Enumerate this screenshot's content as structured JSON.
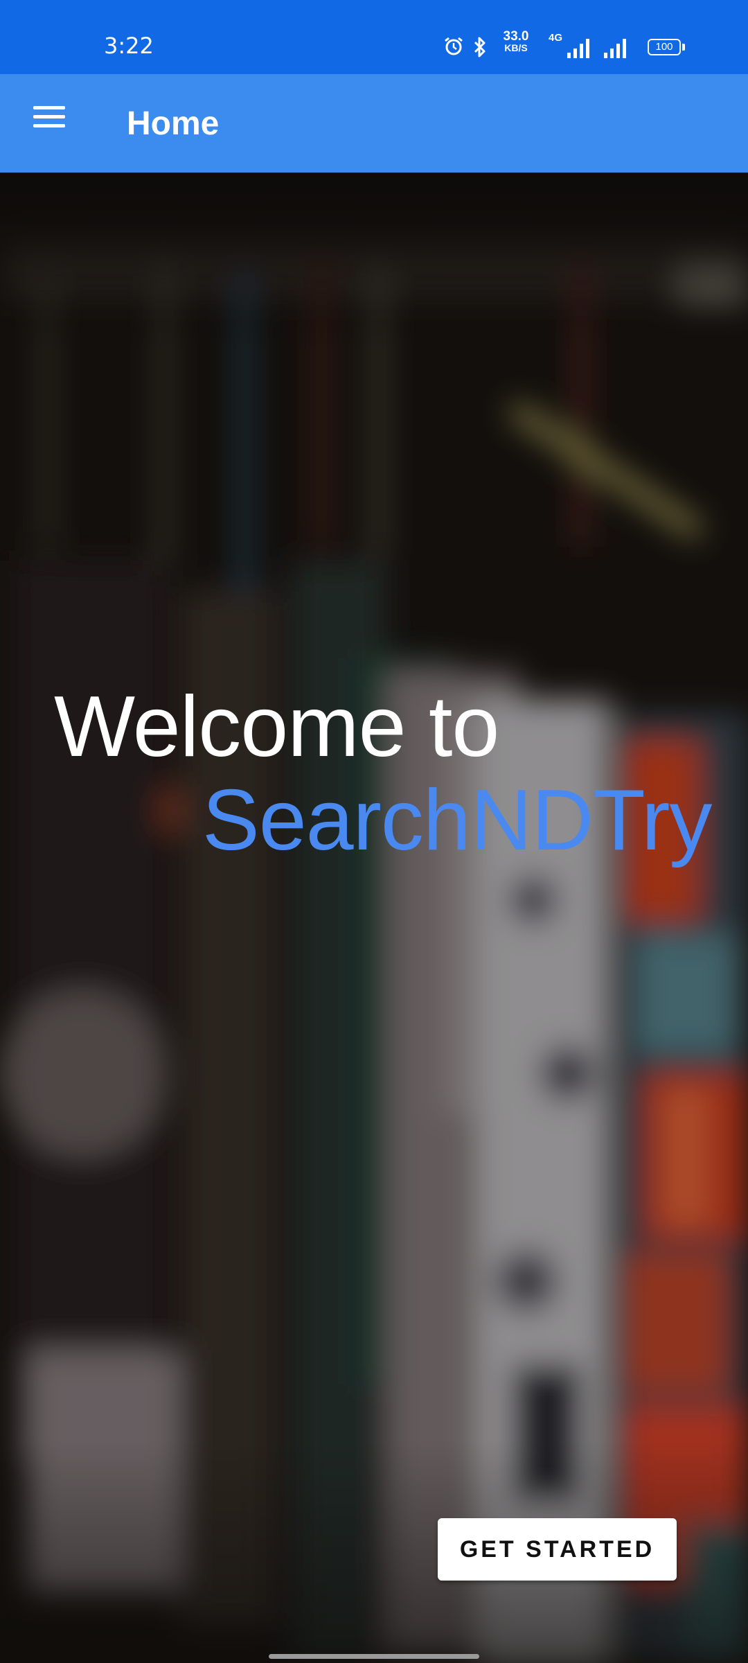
{
  "status_bar": {
    "time": "3:22",
    "network_speed": "33.0",
    "network_speed_unit": "KB/S",
    "network_type": "4G",
    "battery": "100",
    "icons": [
      "alarm-icon",
      "bluetooth-icon",
      "signal-icon",
      "signal-icon",
      "battery-icon"
    ]
  },
  "app_bar": {
    "menu_icon": "menu-icon",
    "title": "Home"
  },
  "hero": {
    "background": "blurred-clothes-rack-photo",
    "welcome_line1": "Welcome to",
    "welcome_line2": "SearchNDTry",
    "button_label": "GET STARTED"
  },
  "colors": {
    "status_bar": "#1169e6",
    "app_bar": "#3c8bef",
    "accent_text": "#4a8af0"
  }
}
